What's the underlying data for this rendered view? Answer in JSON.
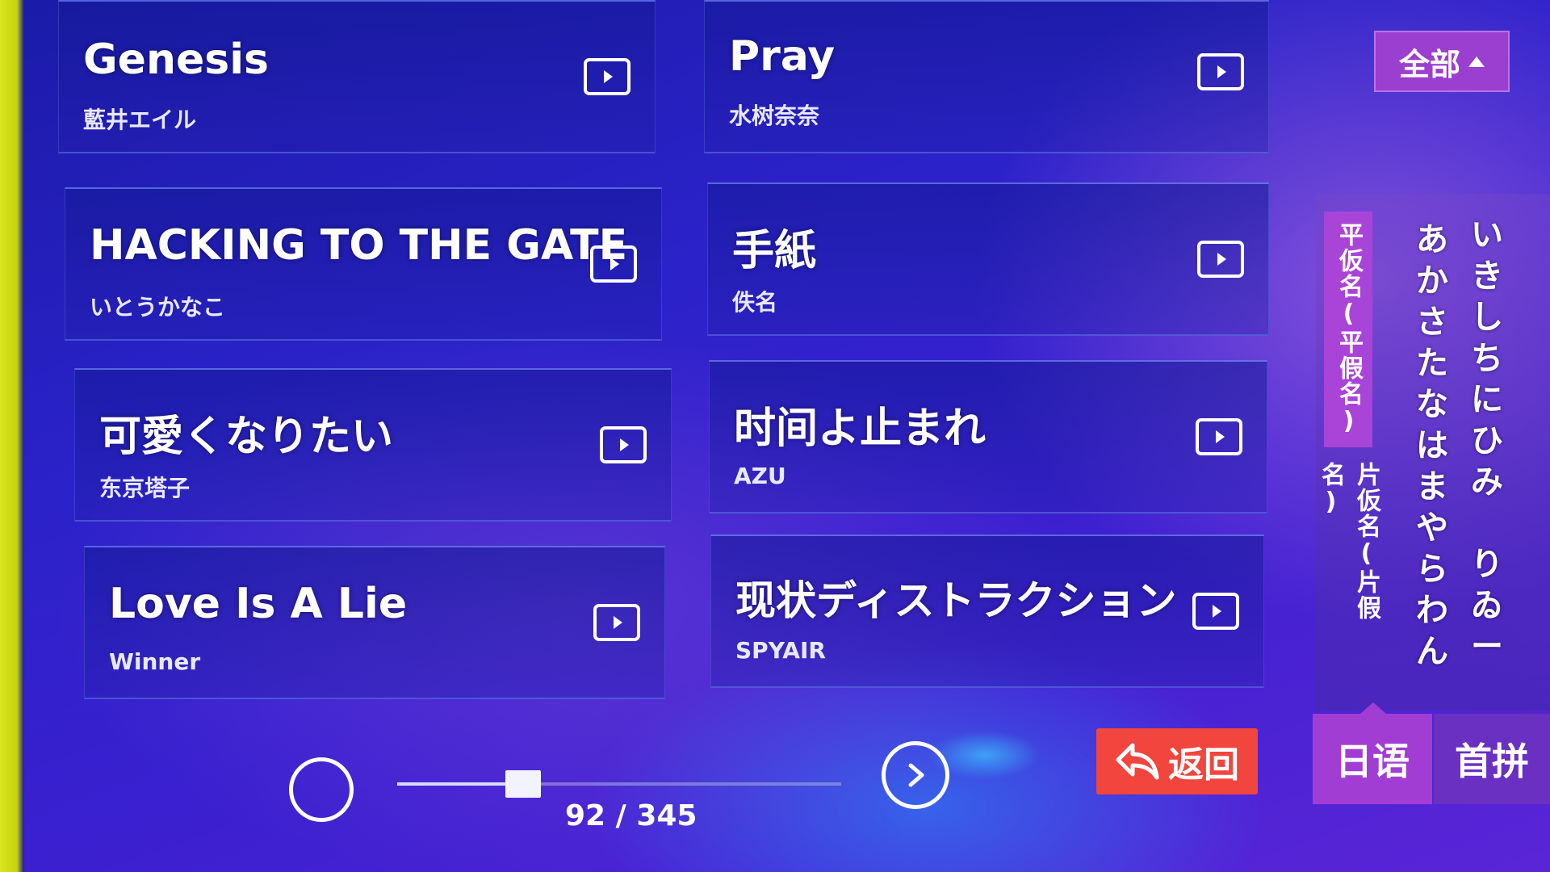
{
  "songs": [
    {
      "title": "Genesis",
      "artist": "藍井エイル"
    },
    {
      "title": "Pray",
      "artist": "水树奈奈"
    },
    {
      "title": "HACKING TO THE GATE",
      "artist": "いとうかなこ"
    },
    {
      "title": "手紙",
      "artist": "佚名"
    },
    {
      "title": "可愛くなりたい",
      "artist": "东京塔子"
    },
    {
      "title": "时间よ止まれ",
      "artist": "AZU"
    },
    {
      "title": "Love Is A Lie",
      "artist": "Winner"
    },
    {
      "title": "现状ディストラクション",
      "artist": "SPYAIR"
    }
  ],
  "filter": {
    "label": "全部"
  },
  "kana_tabs": {
    "hiragana": "平仮名(平假名)",
    "katakana": "片仮名(片假名)"
  },
  "kana_columns": [
    [
      "あ",
      "か",
      "さ",
      "た",
      "な",
      "は",
      "ま",
      "や",
      "ら",
      "わ",
      "ん"
    ],
    [
      "い",
      "き",
      "し",
      "ち",
      "に",
      "ひ",
      "み",
      "",
      "り",
      "ゐ",
      "ー"
    ]
  ],
  "language_buttons": {
    "japanese": "日语",
    "pinyin": "首拼"
  },
  "back_button": {
    "label": "返回"
  },
  "pagination": {
    "text": "92 / 345",
    "current": 92,
    "total": 345
  },
  "colors": {
    "accent_purple": "#a23dd4",
    "back_red": "#f2453d",
    "background_blue": "#2b22c9"
  }
}
